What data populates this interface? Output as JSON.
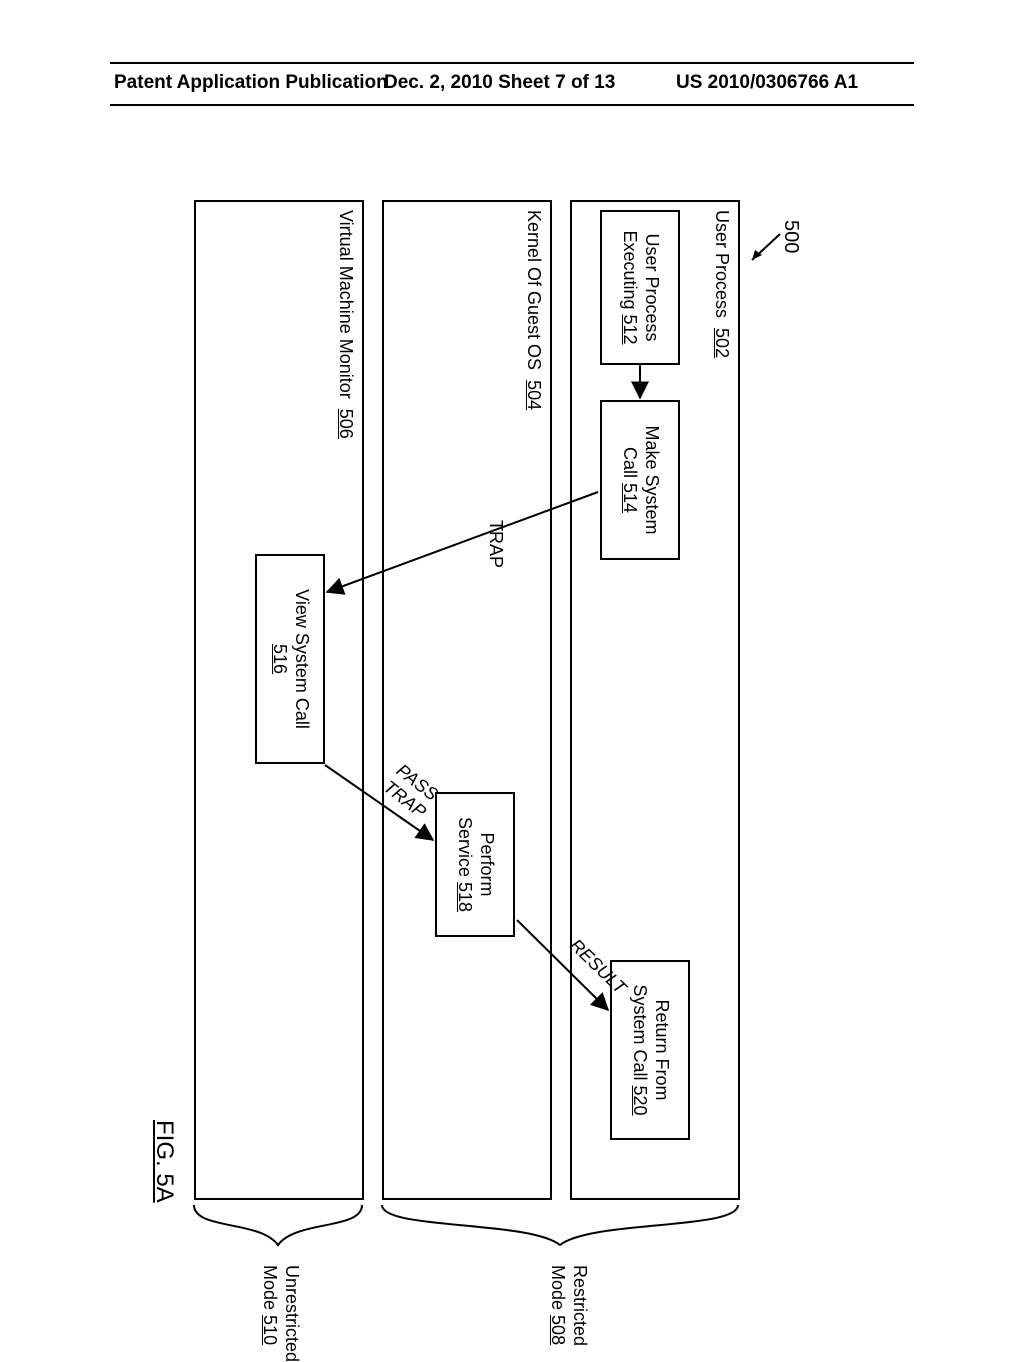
{
  "header": {
    "left": "Patent Application Publication",
    "center": "Dec. 2, 2010  Sheet 7 of 13",
    "right": "US 2010/0306766 A1"
  },
  "figure": {
    "id": "500",
    "label": "FIG. 5A",
    "lanes": {
      "user_process": {
        "title": "User Process",
        "ref": "502"
      },
      "kernel": {
        "title": "Kernel Of Guest OS",
        "ref": "504"
      },
      "vmm": {
        "title": "Virtual Machine Monitor",
        "ref": "506"
      }
    },
    "modes": {
      "restricted": {
        "title": "Restricted",
        "line2": "Mode",
        "ref": "508"
      },
      "unrestricted": {
        "title": "Unrestricted",
        "line2": "Mode",
        "ref": "510"
      }
    },
    "boxes": {
      "executing": {
        "line1": "User Process",
        "line2": "Executing",
        "ref": "512"
      },
      "make_call": {
        "line1": "Make System",
        "line2": "Call",
        "ref": "514"
      },
      "view_call": {
        "line1": "View System Call",
        "ref": "516"
      },
      "perform": {
        "line1": "Perform",
        "line2": "Service",
        "ref": "518"
      },
      "return": {
        "line1": "Return From",
        "line2": "System Call",
        "ref": "520"
      }
    },
    "arrows": {
      "trap": "TRAP",
      "pass_trap": "PASS TRAP",
      "result": "RESULT"
    }
  }
}
